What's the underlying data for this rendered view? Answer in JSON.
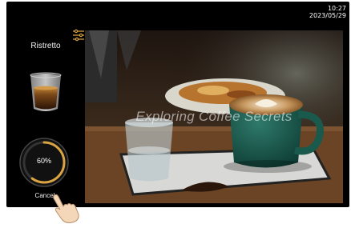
{
  "status": {
    "time": "10:27",
    "date": "2023/05/29"
  },
  "drink": {
    "name": "Ristretto"
  },
  "progress": {
    "percent": 60,
    "label": "60%"
  },
  "actions": {
    "cancel_label": "Cancel"
  },
  "background": {
    "caption": "Exploring Coffee Secrets"
  },
  "icons": {
    "settings": "sliders-icon",
    "cup": "espresso-glass-icon",
    "hand": "pointing-hand-icon"
  },
  "colors": {
    "accent": "#d9a441",
    "screen": "#000000"
  }
}
